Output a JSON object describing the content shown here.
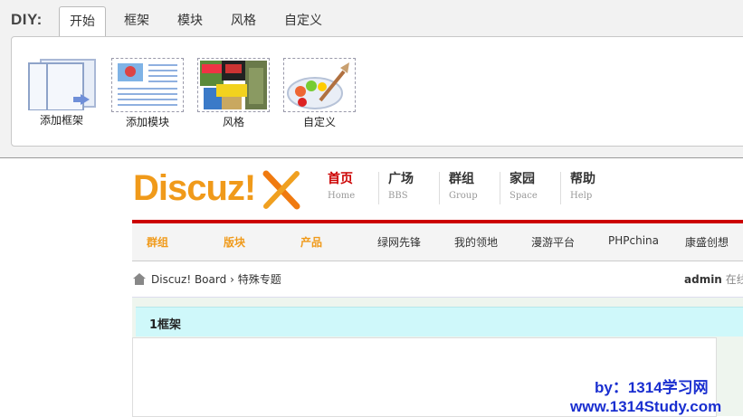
{
  "diy": {
    "label": "DIY:",
    "tabs": [
      {
        "label": "开始",
        "active": true
      },
      {
        "label": "框架"
      },
      {
        "label": "模块"
      },
      {
        "label": "风格"
      },
      {
        "label": "自定义"
      }
    ],
    "tools": [
      {
        "label": "添加框架",
        "icon": "add-frame-icon"
      },
      {
        "label": "添加模块",
        "icon": "add-module-icon"
      },
      {
        "label": "风格",
        "icon": "style-icon"
      },
      {
        "label": "自定义",
        "icon": "palette-icon"
      }
    ]
  },
  "site": {
    "logo": "Discuz!",
    "nav": [
      {
        "zh": "首页",
        "en": "Home",
        "active": true
      },
      {
        "zh": "广场",
        "en": "BBS"
      },
      {
        "zh": "群组",
        "en": "Group"
      },
      {
        "zh": "家园",
        "en": "Space"
      },
      {
        "zh": "帮助",
        "en": "Help"
      }
    ],
    "subnav": [
      "群组",
      "版块",
      "产品",
      "绿网先锋",
      "我的领地",
      "漫游平台",
      "PHPchina",
      "康盛创想"
    ],
    "breadcrumb": {
      "home": "Discuz! Board",
      "separator": "›",
      "current": "特殊专题"
    },
    "user": {
      "name": "admin",
      "status": "在线"
    },
    "frame_title": "1框架"
  },
  "watermark": {
    "line1": "by：1314学习网",
    "line2": "www.1314Study.com"
  },
  "colors": {
    "accent": "#cc0000",
    "logo": "#f09a1a",
    "frame_head": "#cff8fa",
    "watermark": "#1a2fd0"
  }
}
